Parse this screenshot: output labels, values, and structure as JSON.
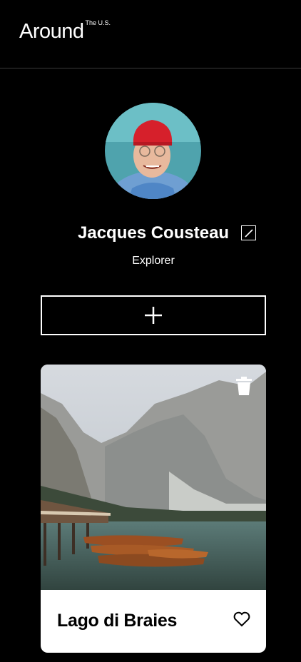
{
  "header": {
    "logo_text": "Around",
    "logo_superscript": "The U.S."
  },
  "profile": {
    "name": "Jacques Cousteau",
    "job": "Explorer",
    "edit_icon": "pencil-square-icon",
    "avatar_icon": "profile-photo"
  },
  "add_button": {
    "icon": "plus-icon"
  },
  "cards": [
    {
      "title": "Lago di Braies",
      "image": "mountain-lake-with-boats-photo",
      "delete_icon": "trash-icon",
      "like_icon": "heart-outline-icon"
    }
  ],
  "colors": {
    "background": "#000000",
    "text": "#ffffff",
    "card_background": "#ffffff",
    "card_text": "#000000"
  }
}
